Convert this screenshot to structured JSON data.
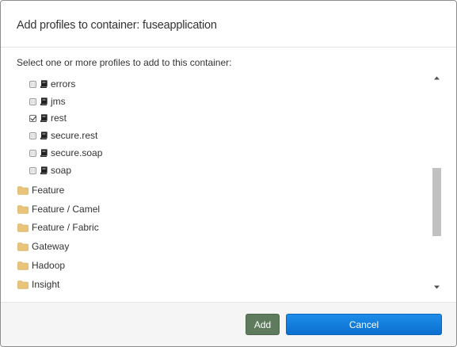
{
  "dialog": {
    "title": "Add profiles to container: fuseapplication",
    "instruction": "Select one or more profiles to add to this container:"
  },
  "profiles": [
    {
      "label": "errors",
      "checked": false,
      "icon": "book-icon"
    },
    {
      "label": "jms",
      "checked": false,
      "icon": "book-icon"
    },
    {
      "label": "rest",
      "checked": true,
      "icon": "book-icon"
    },
    {
      "label": "secure.rest",
      "checked": false,
      "icon": "book-icon"
    },
    {
      "label": "secure.soap",
      "checked": false,
      "icon": "book-icon"
    },
    {
      "label": "soap",
      "checked": false,
      "icon": "book-icon"
    }
  ],
  "folders": [
    {
      "label": "Feature",
      "icon": "folder-icon"
    },
    {
      "label": "Feature / Camel",
      "icon": "folder-icon"
    },
    {
      "label": "Feature / Fabric",
      "icon": "folder-icon"
    },
    {
      "label": "Gateway",
      "icon": "folder-icon"
    },
    {
      "label": "Hadoop",
      "icon": "folder-icon"
    },
    {
      "label": "Insight",
      "icon": "folder-icon"
    }
  ],
  "footer": {
    "add_label": "Add",
    "cancel_label": "Cancel"
  },
  "colors": {
    "add_button": "#5f7b5e",
    "cancel_button": "#1a86e0",
    "folder": "#e8c47a"
  }
}
